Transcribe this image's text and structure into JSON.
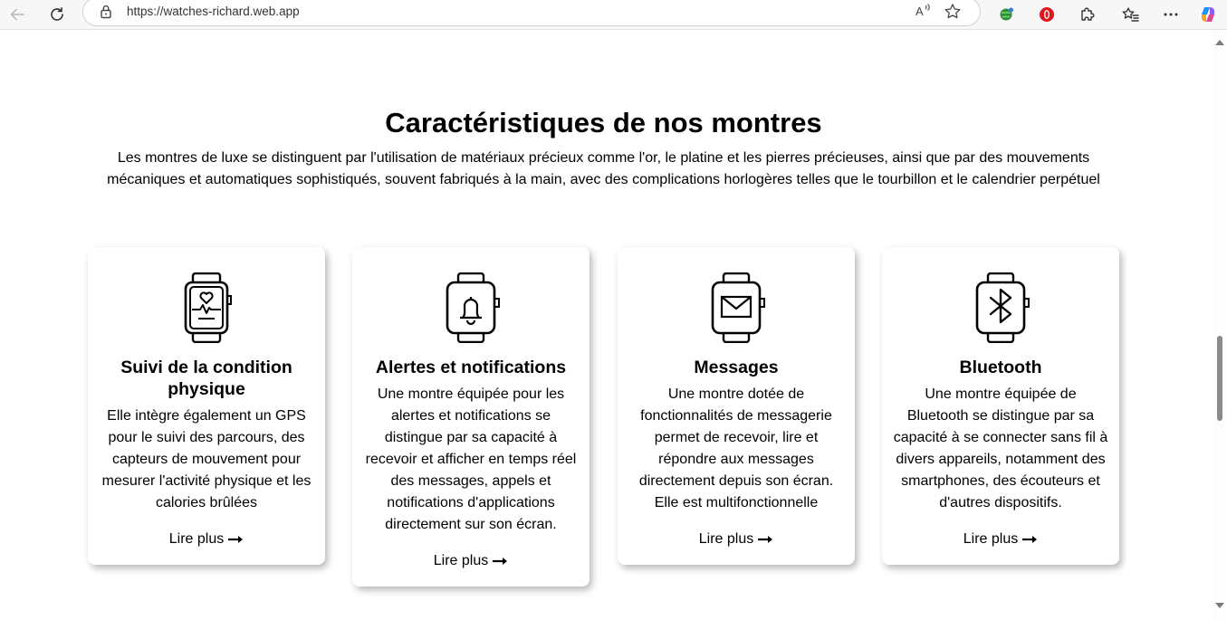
{
  "browser": {
    "url": "https://watches-richard.web.app"
  },
  "section": {
    "title": "Caractéristiques de nos montres",
    "description": "Les montres de luxe se distinguent par l'utilisation de matériaux précieux comme l'or, le platine et les pierres précieuses, ainsi que par des mouvements mécaniques et automatiques sophistiqués, souvent fabriqués à la main, avec des complications horlogères telles que le tourbillon et le calendrier perpétuel"
  },
  "cards": [
    {
      "icon": "smartwatch-heart-icon",
      "title": "Suivi de la condition physique",
      "text": "Elle intègre également un GPS pour le suivi des parcours, des capteurs de mouvement pour mesurer l'activité physique et les calories brûlées",
      "link": "Lire plus"
    },
    {
      "icon": "smartwatch-bell-icon",
      "title": "Alertes et notifications",
      "text": "Une montre équipée pour les alertes et notifications se distingue par sa capacité à recevoir et afficher en temps réel des messages, appels et notifications d'applications directement sur son écran.",
      "link": "Lire plus"
    },
    {
      "icon": "smartwatch-message-icon",
      "title": "Messages",
      "text": "Une montre dotée de fonctionnalités de messagerie permet de recevoir, lire et répondre aux messages directement depuis son écran. Elle est multifonctionnelle",
      "link": "Lire plus"
    },
    {
      "icon": "smartwatch-bluetooth-icon",
      "title": "Bluetooth",
      "text": "Une montre équipée de Bluetooth se distingue par sa capacité à se connecter sans fil à divers appareils, notamment des smartphones, des écouteurs et d'autres dispositifs.",
      "link": "Lire plus"
    }
  ]
}
